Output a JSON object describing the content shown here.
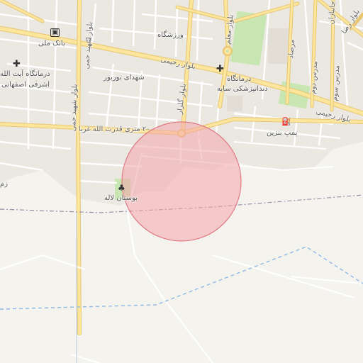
{
  "map": {
    "labels": {
      "bank_melli": "بانک ملی",
      "varzeshgah": "ورزشگاه",
      "clinic_ayatollah": "درمانگاه آیت الله",
      "clinic_ashrafi": "اشرفی اصفهانی",
      "shohada_boorboor": "شهدای بوربور",
      "blvd_rahimi_1": "بلوار رحیمی",
      "blvd_rahimi_2": "بلوار رحیمی",
      "clinic": "درمانگاه",
      "dental_saye": "دندانپزشکی سایه",
      "blvd_moallem": "بلوار معلم",
      "blvd_reza": "بلوار رضا",
      "marsad": "مرصاد",
      "modares_dovom": "مدرس دوم",
      "modares_sevom": "مدرس سوم",
      "janbazan": "جانبازان",
      "shahid_hamm": "بلوار شهید حمی",
      "golzar": "بلوار گلزار",
      "street_20m": "۲۰ متری قدرت الله غربا",
      "gas_station": "پمپ بنزین",
      "park_laleh": "بوستان لاله",
      "edge_z": "زم"
    },
    "icons": [
      "bank-icon",
      "shopping-bag-icon",
      "medical-cross-icon",
      "fuel-pump-icon",
      "park-tree-icon",
      "roundabout-icon"
    ],
    "colors": {
      "background": "#f5f3ee",
      "road": "#fce59c",
      "park": "#c8e6b2",
      "area_circle_fill": "#f4a6ab",
      "area_circle_stroke": "#e07a82",
      "water_dashed": "#8fb8e8",
      "boundary": "#9a8fa8"
    }
  }
}
